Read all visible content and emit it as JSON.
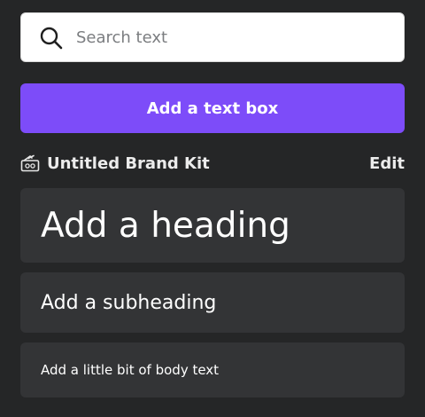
{
  "search": {
    "placeholder": "Search text",
    "value": "",
    "icon": "search-icon"
  },
  "add_text_box": {
    "label": "Add a text box",
    "color": "#7d4cf9"
  },
  "brand_kit": {
    "icon": "brand-kit-icon",
    "name": "Untitled Brand Kit",
    "edit_label": "Edit"
  },
  "text_styles": [
    {
      "label": "Add a heading"
    },
    {
      "label": "Add a subheading"
    },
    {
      "label": "Add a little bit of body text"
    }
  ],
  "colors": {
    "background": "#252627",
    "tile": "#333436",
    "accent": "#7d4cf9"
  }
}
